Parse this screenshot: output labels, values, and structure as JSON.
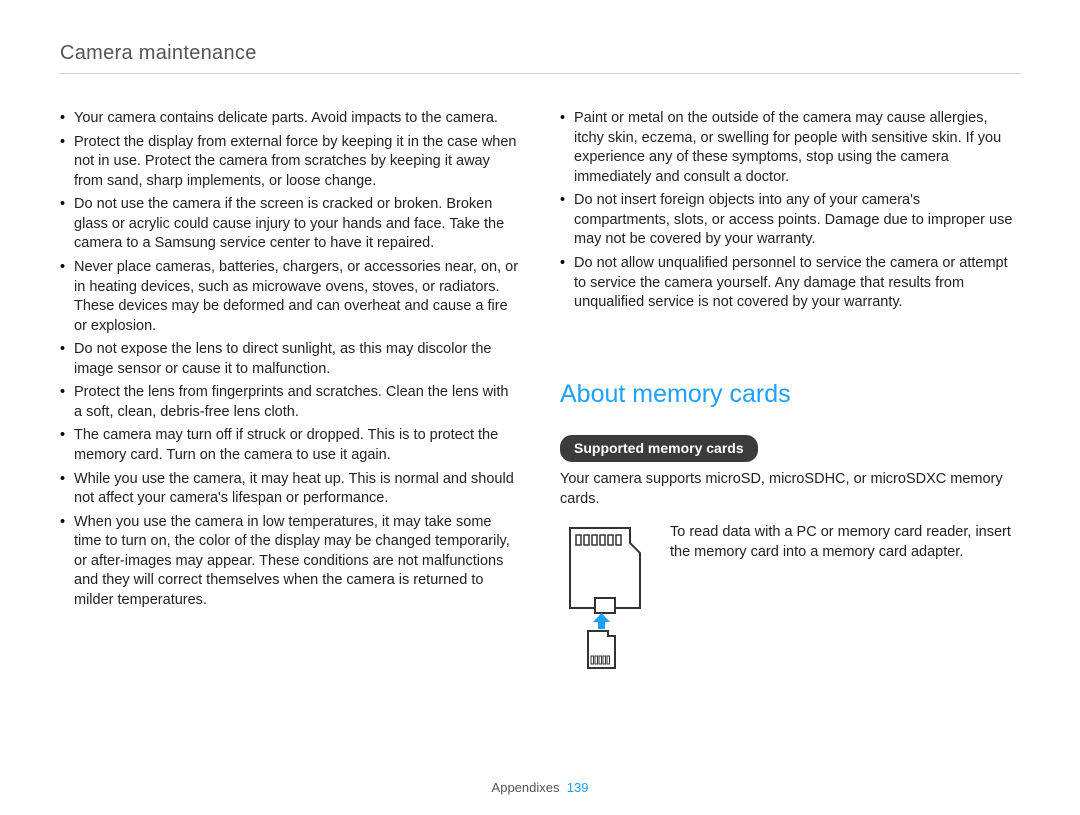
{
  "header": "Camera maintenance",
  "left_bullets": [
    "Your camera contains delicate parts. Avoid impacts to the camera.",
    "Protect the display from external force by keeping it in the case when not in use. Protect the camera from scratches by keeping it away from sand, sharp implements, or loose change.",
    "Do not use the camera if the screen is cracked or broken. Broken glass or acrylic could cause injury to your hands and face. Take the camera to a Samsung service center to have it repaired.",
    "Never place cameras, batteries, chargers, or accessories near, on, or in heating devices, such as microwave ovens, stoves, or radiators. These devices may be deformed and can overheat and cause a fire or explosion.",
    "Do not expose the lens to direct sunlight, as this may discolor the image sensor or cause it to malfunction.",
    "Protect the lens from fingerprints and scratches. Clean the lens with a soft, clean, debris-free lens cloth.",
    "The camera may turn off if struck or dropped. This is to protect the memory card. Turn on the camera to use it again.",
    "While you use the camera, it may heat up. This is normal and should not affect your camera's lifespan or performance.",
    "When you use the camera in low temperatures, it may take some time to turn on, the color of the display may be changed temporarily, or after-images may appear. These conditions are not malfunctions and they will correct themselves when the camera is returned to milder temperatures."
  ],
  "right_bullets": [
    "Paint or metal on the outside of the camera may cause allergies, itchy skin, eczema, or swelling for people with sensitive skin. If you experience any of these symptoms, stop using the camera immediately and consult a doctor.",
    "Do not insert foreign objects into any of your camera's compartments, slots, or access points. Damage due to improper use may not be covered by your warranty.",
    "Do not allow unqualified personnel to service the camera or attempt to service the camera yourself. Any damage that results from unqualified service is not covered by your warranty."
  ],
  "section_title": "About memory cards",
  "pill_label": "Supported memory cards",
  "memory_intro": "Your camera supports microSD, microSDHC, or microSDXC memory cards.",
  "memory_adapter": "To read data with a PC or memory card reader, insert the memory card into a memory card adapter.",
  "footer_label": "Appendixes",
  "page_number": "139"
}
